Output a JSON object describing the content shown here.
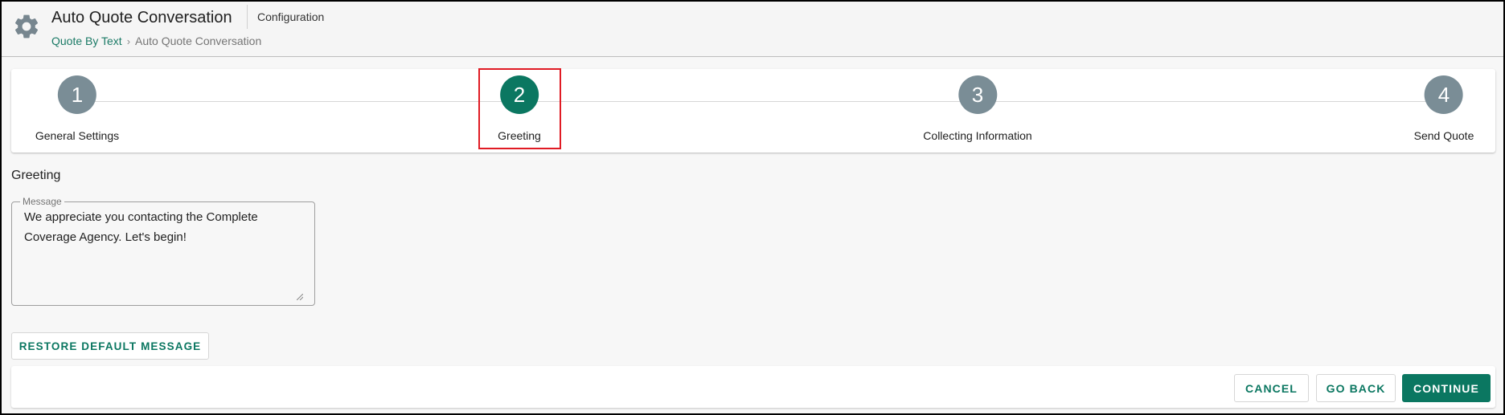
{
  "header": {
    "title": "Auto Quote Conversation",
    "section": "Configuration",
    "breadcrumb": {
      "link": "Quote By Text",
      "current": "Auto Quote Conversation"
    },
    "icon": "gear-icon"
  },
  "stepper": {
    "steps": [
      {
        "number": "1",
        "label": "General Settings",
        "active": false
      },
      {
        "number": "2",
        "label": "Greeting",
        "active": true
      },
      {
        "number": "3",
        "label": "Collecting Information",
        "active": false
      },
      {
        "number": "4",
        "label": "Send Quote",
        "active": false
      }
    ]
  },
  "content": {
    "section_title": "Greeting",
    "message_label": "Message",
    "message_value": "We appreciate you contacting the Complete Coverage Agency. Let's begin!",
    "restore_label": "RESTORE DEFAULT MESSAGE"
  },
  "footer": {
    "cancel_label": "CANCEL",
    "back_label": "GO BACK",
    "continue_label": "CONTINUE"
  },
  "colors": {
    "accent": "#0b7761",
    "step_inactive": "#7a8d96",
    "highlight": "#e01b24"
  }
}
